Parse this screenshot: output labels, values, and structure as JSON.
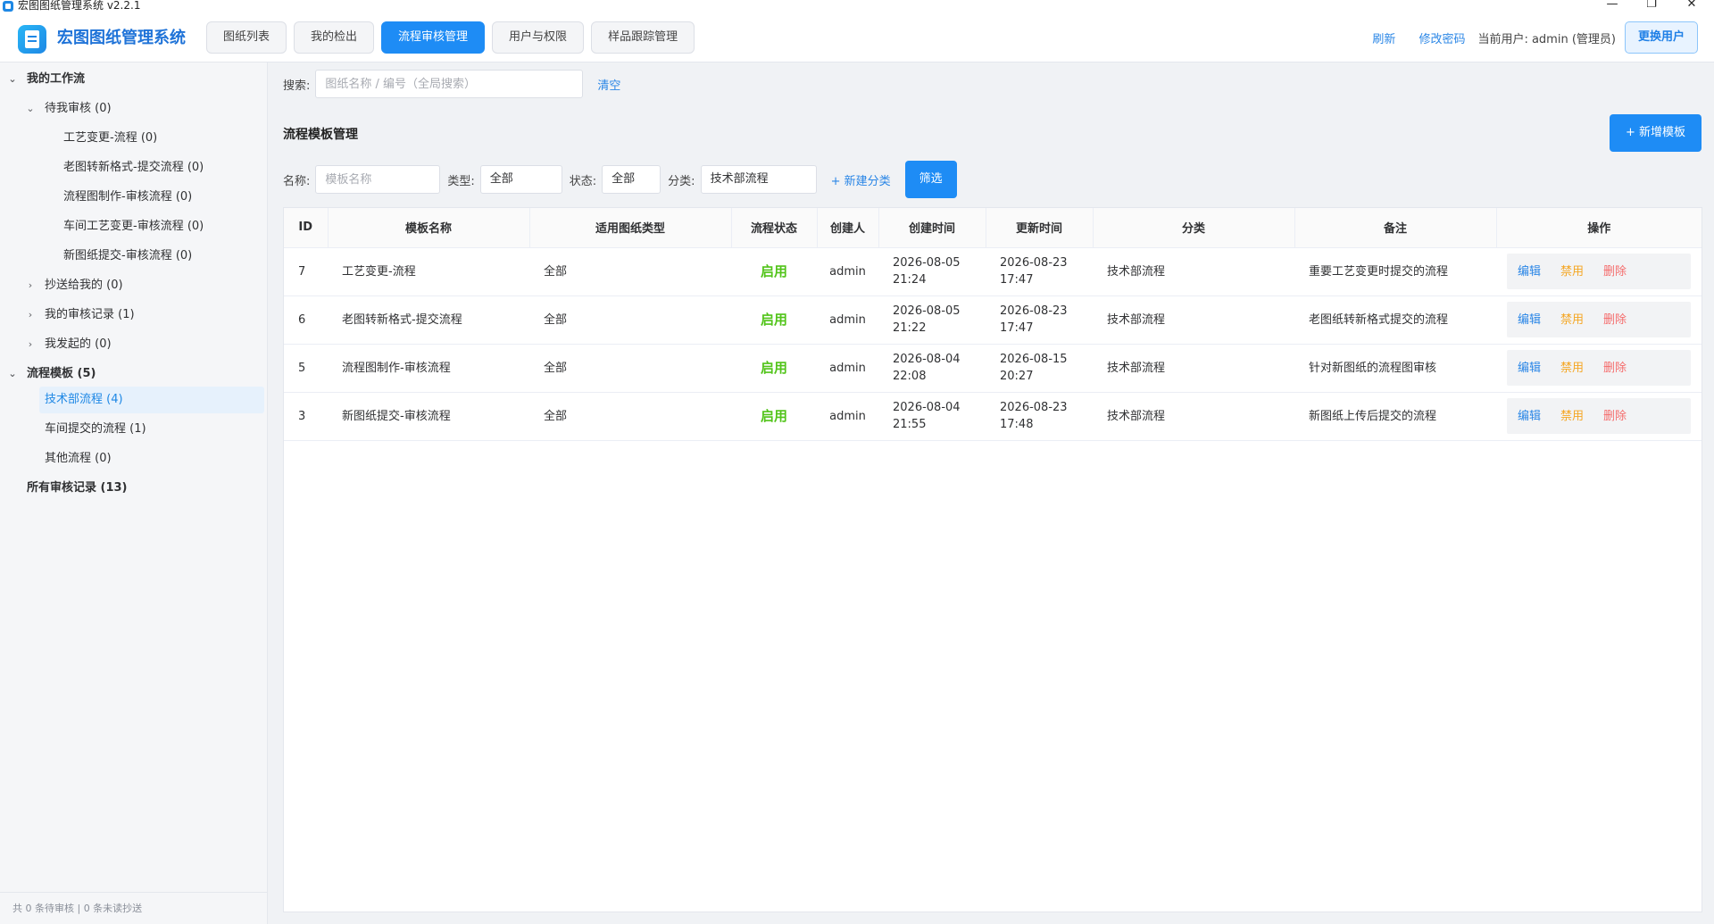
{
  "window": {
    "title": "宏图图纸管理系统  v2.2.1",
    "minimize": "—",
    "restore": "❐",
    "close": "✕"
  },
  "header": {
    "brand": "宏图图纸管理系统",
    "tabs": [
      {
        "label": "图纸列表"
      },
      {
        "label": "我的检出"
      },
      {
        "label": "流程审核管理"
      },
      {
        "label": "用户与权限"
      },
      {
        "label": "样品跟踪管理"
      }
    ],
    "active_tab": "流程审核管理",
    "refresh": "刷新",
    "change_password": "修改密码",
    "current_user": "当前用户: admin (管理员)",
    "switch_user": "更换用户"
  },
  "sidebar": {
    "nodes": [
      {
        "label": "我的工作流"
      },
      {
        "label": "待我审核 (0)"
      },
      {
        "label": "工艺变更-流程 (0)"
      },
      {
        "label": "老图转新格式-提交流程 (0)"
      },
      {
        "label": "流程图制作-审核流程 (0)"
      },
      {
        "label": "车间工艺变更-审核流程 (0)"
      },
      {
        "label": "新图纸提交-审核流程 (0)"
      },
      {
        "label": "抄送给我的 (0)"
      },
      {
        "label": "我的审核记录 (1)"
      },
      {
        "label": "我发起的 (0)"
      },
      {
        "label": "流程模板 (5)"
      },
      {
        "label": "技术部流程 (4)"
      },
      {
        "label": "车间提交的流程 (1)"
      },
      {
        "label": "其他流程 (0)"
      },
      {
        "label": "所有审核记录 (13)"
      }
    ],
    "footer": "共 0 条待审核  |  0 条未读抄送"
  },
  "search": {
    "label": "搜索:",
    "placeholder": "图纸名称 / 编号（全局搜索）",
    "clear": "清空"
  },
  "section": {
    "title": "流程模板管理",
    "add_button": "+ 新增模板"
  },
  "filters": {
    "name_label": "名称:",
    "name_placeholder": "模板名称",
    "type_label": "类型:",
    "type_value": "全部",
    "status_label": "状态:",
    "status_value": "全部",
    "category_label": "分类:",
    "category_value": "技术部流程",
    "new_category": "+ 新建分类",
    "filter_button": "筛选"
  },
  "table": {
    "headers": [
      "ID",
      "模板名称",
      "适用图纸类型",
      "流程状态",
      "创建人",
      "创建时间",
      "更新时间",
      "分类",
      "备注",
      "操作"
    ],
    "rows": [
      {
        "id": "7",
        "name": "工艺变更-流程",
        "type": "全部",
        "status": "启用",
        "creator": "admin",
        "created": "2026-08-05 21:24",
        "updated": "2026-08-23 17:47",
        "category": "技术部流程",
        "note": "重要工艺变更时提交的流程"
      },
      {
        "id": "6",
        "name": "老图转新格式-提交流程",
        "type": "全部",
        "status": "启用",
        "creator": "admin",
        "created": "2026-08-05 21:22",
        "updated": "2026-08-23 17:47",
        "category": "技术部流程",
        "note": "老图纸转新格式提交的流程"
      },
      {
        "id": "5",
        "name": "流程图制作-审核流程",
        "type": "全部",
        "status": "启用",
        "creator": "admin",
        "created": "2026-08-04 22:08",
        "updated": "2026-08-15 20:27",
        "category": "技术部流程",
        "note": "针对新图纸的流程图审核"
      },
      {
        "id": "3",
        "name": "新图纸提交-审核流程",
        "type": "全部",
        "status": "启用",
        "creator": "admin",
        "created": "2026-08-04 21:55",
        "updated": "2026-08-23 17:48",
        "category": "技术部流程",
        "note": "新图纸上传后提交的流程"
      }
    ],
    "actions": {
      "edit": "编辑",
      "disable": "禁用",
      "delete": "删除"
    }
  },
  "colors": {
    "accent": "#1e8cf5",
    "enabled": "#52c41a",
    "disable_action": "#f5a623",
    "delete_action": "#f56c6c"
  }
}
